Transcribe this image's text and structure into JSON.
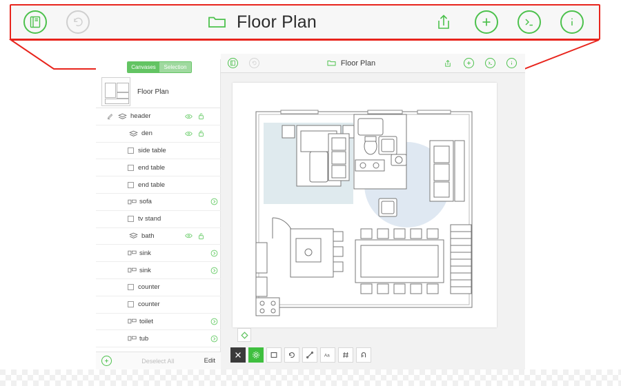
{
  "zoom_toolbar": {
    "title": "Floor Plan",
    "left_icons": [
      {
        "name": "document-outline-icon",
        "glyph": "document"
      },
      {
        "name": "undo-icon",
        "glyph": "undo"
      }
    ],
    "title_icon": "folder-icon",
    "right_icons": [
      {
        "name": "share-icon",
        "glyph": "share"
      },
      {
        "name": "add-icon",
        "glyph": "plus"
      },
      {
        "name": "console-icon",
        "glyph": "console"
      },
      {
        "name": "info-icon",
        "glyph": "info"
      }
    ]
  },
  "app_toolbar": {
    "title": "Floor Plan"
  },
  "sidebar": {
    "segmented": {
      "left_label": "Canvases",
      "right_label": "Selection"
    },
    "canvas": {
      "name": "Floor Plan"
    },
    "rows": [
      {
        "label": "header",
        "type": "group",
        "indent": 1,
        "eye": true,
        "lock": true,
        "chevron": false,
        "pencil": true
      },
      {
        "label": "den",
        "type": "group",
        "indent": 2,
        "eye": true,
        "lock": true,
        "chevron": false,
        "pencil": false
      },
      {
        "label": "side table",
        "type": "item-box",
        "indent": 3,
        "eye": false,
        "lock": false,
        "chevron": false,
        "pencil": false
      },
      {
        "label": "end table",
        "type": "item-box",
        "indent": 3,
        "eye": false,
        "lock": false,
        "chevron": false,
        "pencil": false
      },
      {
        "label": "end table",
        "type": "item-box",
        "indent": 3,
        "eye": false,
        "lock": false,
        "chevron": false,
        "pencil": false
      },
      {
        "label": "sofa",
        "type": "item-obj",
        "indent": 3,
        "eye": false,
        "lock": false,
        "chevron": true,
        "pencil": false
      },
      {
        "label": "tv stand",
        "type": "item-box",
        "indent": 3,
        "eye": false,
        "lock": false,
        "chevron": false,
        "pencil": false
      },
      {
        "label": "bath",
        "type": "group",
        "indent": 2,
        "eye": true,
        "lock": true,
        "chevron": false,
        "pencil": false
      },
      {
        "label": "sink",
        "type": "item-obj",
        "indent": 3,
        "eye": false,
        "lock": false,
        "chevron": true,
        "pencil": false
      },
      {
        "label": "sink",
        "type": "item-obj",
        "indent": 3,
        "eye": false,
        "lock": false,
        "chevron": true,
        "pencil": false
      },
      {
        "label": "counter",
        "type": "item-box",
        "indent": 3,
        "eye": false,
        "lock": false,
        "chevron": false,
        "pencil": false
      },
      {
        "label": "counter",
        "type": "item-box",
        "indent": 3,
        "eye": false,
        "lock": false,
        "chevron": false,
        "pencil": false
      },
      {
        "label": "toilet",
        "type": "item-obj",
        "indent": 3,
        "eye": false,
        "lock": false,
        "chevron": true,
        "pencil": false
      },
      {
        "label": "tub",
        "type": "item-obj",
        "indent": 3,
        "eye": false,
        "lock": false,
        "chevron": true,
        "pencil": false
      }
    ],
    "footer": {
      "add_label": "+",
      "deselect_label": "Deselect All",
      "edit_label": "Edit"
    }
  },
  "colors": {
    "accent_green": "#4cc14c",
    "callout_red": "#e8241c",
    "toolbar_bg": "#f7f7f7",
    "canvas_bg": "#f2f2f2",
    "room_fill": "#dfeaee",
    "rug_fill": "#dfe8f2"
  }
}
